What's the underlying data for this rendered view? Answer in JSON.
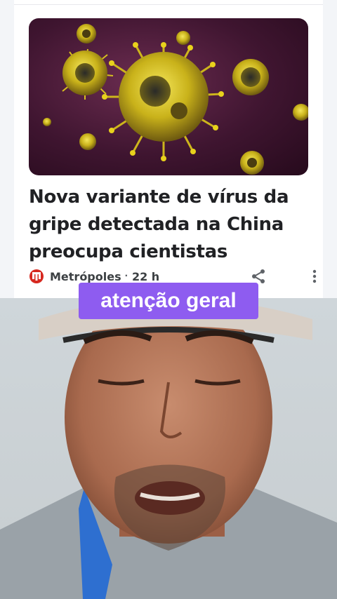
{
  "article": {
    "headline": "Nova variante de vírus da gripe detectada na China preocupa cientistas",
    "publisher": "Metrópoles",
    "separator": "·",
    "time": "22 h",
    "image_subject": "virus-illustration"
  },
  "overlay": {
    "caption": "atenção geral"
  },
  "colors": {
    "caption_bg": "#8e5cf0",
    "publisher_red": "#d6281f",
    "virus_yellow": "#e8d21c"
  }
}
